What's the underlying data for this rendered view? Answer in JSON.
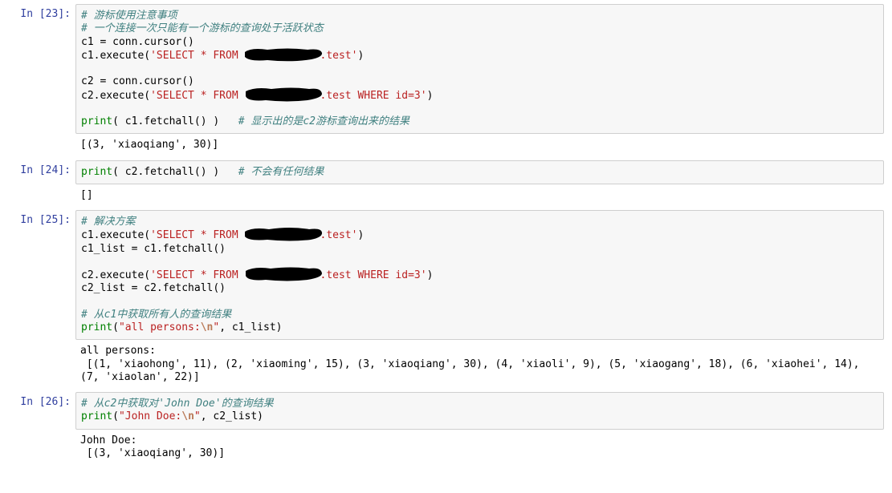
{
  "cells": {
    "c23": {
      "prompt": "In [23]:",
      "comment1": "# 游标使用注意事项",
      "comment2": "# 一个连接一次只能有一个游标的查询处于活跃状态",
      "line3a": "c1 = conn.cursor()",
      "line4a": "c1.execute(",
      "line4_str1": "'SELECT * FROM ",
      "line4_str2": ".test'",
      "line4_end": ")",
      "line6a": "c2 = conn.cursor()",
      "line7a": "c2.execute(",
      "line7_str1": "'SELECT * FROM ",
      "line7_str2": ".test WHERE id=3'",
      "line7_end": ")",
      "line9_print": "print",
      "line9_rest": "( c1.fetchall() )   ",
      "line9_comment": "# 显示出的是c2游标查询出来的结果",
      "output": "[(3, 'xiaoqiang', 30)]"
    },
    "c24": {
      "prompt": "In [24]:",
      "print": "print",
      "rest": "( c2.fetchall() )   ",
      "comment": "# 不会有任何结果",
      "output": "[]"
    },
    "c25": {
      "prompt": "In [25]:",
      "comment1": "# 解决方案",
      "line2a": "c1.execute(",
      "line2_str1": "'SELECT * FROM ",
      "line2_str2": ".test'",
      "line2_end": ")",
      "line3": "c1_list = c1.fetchall()",
      "line5a": "c2.execute(",
      "line5_str1": "'SELECT * FROM ",
      "line5_str2": ".test WHERE id=3'",
      "line5_end": ")",
      "line6": "c2_list = c2.fetchall()",
      "comment2": "# 从c1中获取所有人的查询结果",
      "print": "print",
      "print_open": "(",
      "print_str": "\"all persons:",
      "print_esc": "\\n",
      "print_str_end": "\"",
      "print_rest": ", c1_list)",
      "output": "all persons:\n [(1, 'xiaohong', 11), (2, 'xiaoming', 15), (3, 'xiaoqiang', 30), (4, 'xiaoli', 9), (5, 'xiaogang', 18), (6, 'xiaohei', 14), (7, 'xiaolan', 22)]"
    },
    "c26": {
      "prompt": "In [26]:",
      "comment1": "# 从c2中获取对'John Doe'的查询结果",
      "print": "print",
      "print_open": "(",
      "print_str": "\"John Doe:",
      "print_esc": "\\n",
      "print_str_end": "\"",
      "print_rest": ", c2_list)",
      "output": "John Doe:\n [(3, 'xiaoqiang', 30)]"
    }
  }
}
